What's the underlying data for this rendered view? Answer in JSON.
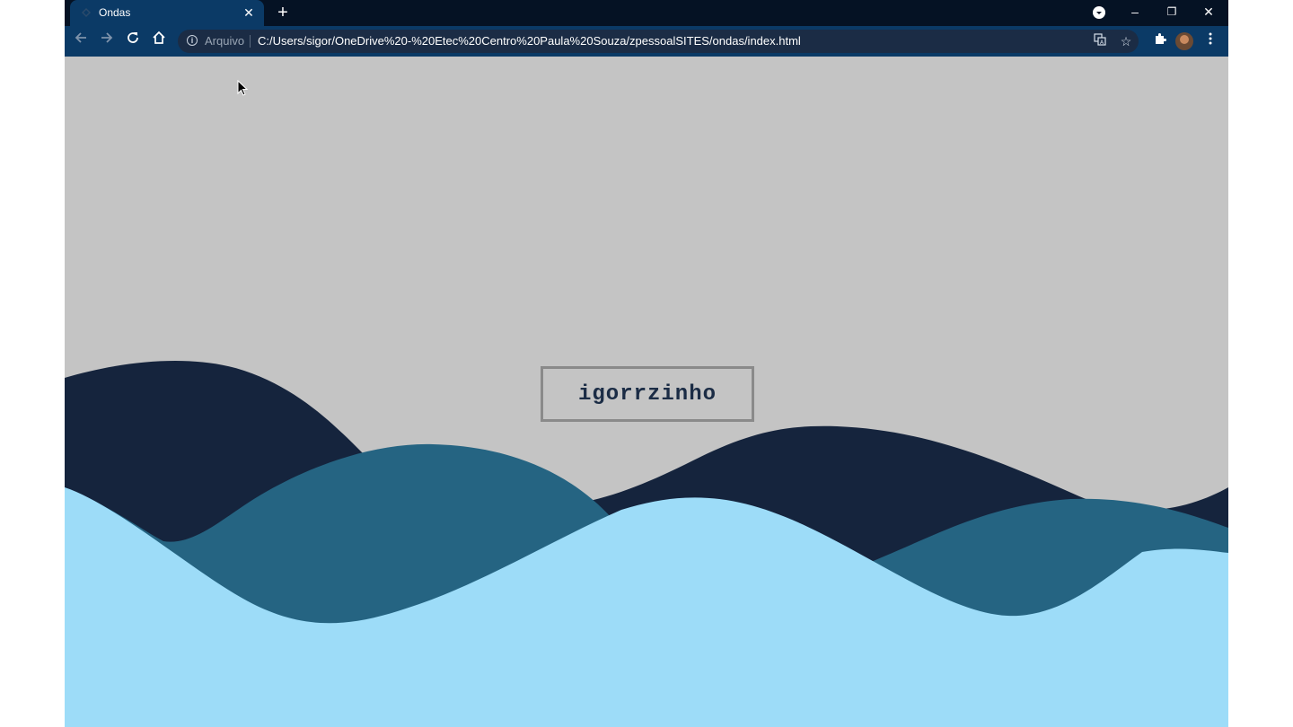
{
  "browser": {
    "tab": {
      "title": "Ondas",
      "close_glyph": "✕"
    },
    "new_tab_glyph": "+",
    "window_controls": {
      "minimize": "–",
      "restore": "❐",
      "close": "✕"
    },
    "omnibox": {
      "scheme_label": "Arquivo",
      "url": "C:/Users/sigor/OneDrive%20-%20Etec%20Centro%20Paula%20Souza/zpessoalSITES/ondas/index.html"
    },
    "icons": [
      "back-icon",
      "forward-icon",
      "reload-icon",
      "home-icon",
      "info-icon",
      "translate-icon",
      "star-icon",
      "extensions-icon",
      "avatar",
      "menu-icon"
    ]
  },
  "page": {
    "brand_text": "igorrzinho",
    "colors": {
      "background": "#c4c4c4",
      "wave_dark": "#15243d",
      "wave_mid": "#256482",
      "wave_light": "#9ddcf8",
      "box_border": "#8a8a8a",
      "brand_text": "#1b2c45"
    }
  }
}
